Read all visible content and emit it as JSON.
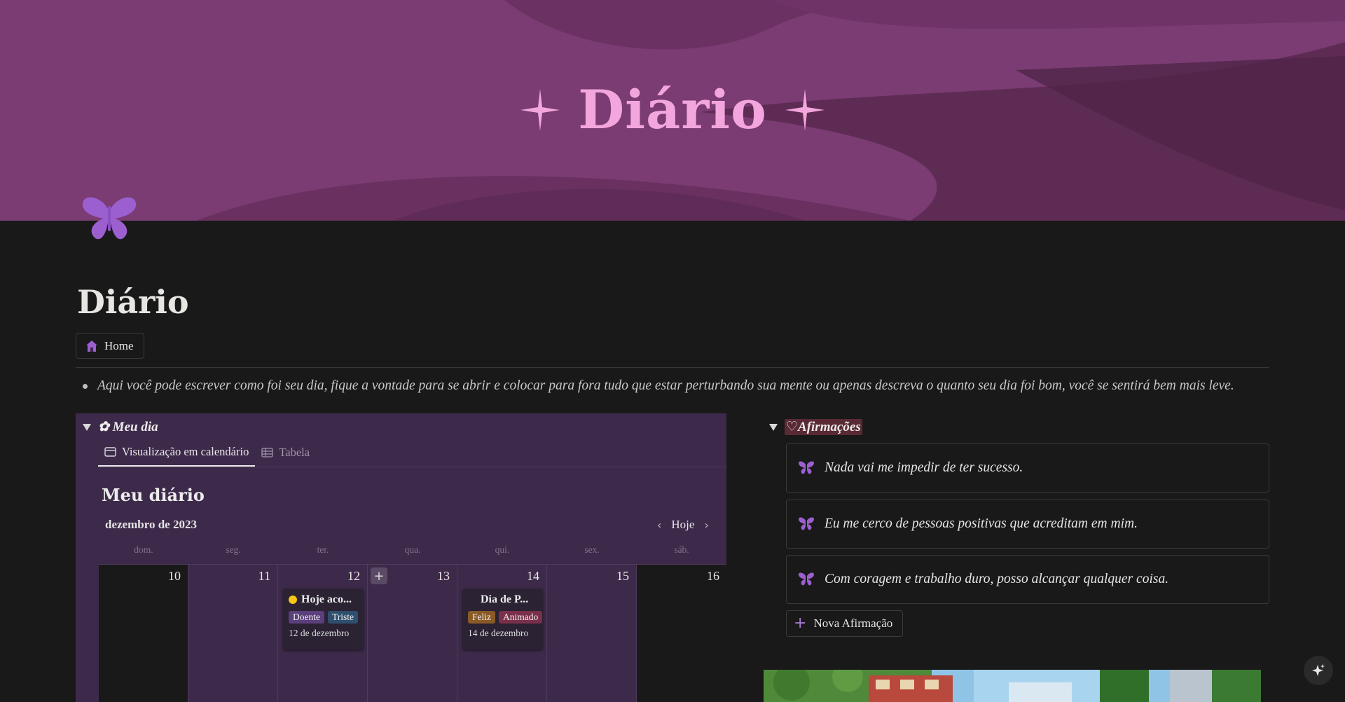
{
  "cover": {
    "title": "Diário"
  },
  "page": {
    "title": "Diário",
    "home_link": "Home",
    "description": "Aqui você pode escrever como foi seu dia, fique a vontade para se abrir e colocar para fora tudo que estar perturbando sua mente ou apenas descreva o quanto seu dia foi bom, você se sentirá bem mais leve."
  },
  "meu_dia": {
    "toggle_label": "✿ Meu dia",
    "tabs": [
      "Visualização em calendário",
      "Tabela"
    ],
    "calendar_title": "Meu diário",
    "month": "dezembro de 2023",
    "today_label": "Hoje",
    "weekdays": [
      "dom.",
      "seg.",
      "ter.",
      "qua.",
      "qui.",
      "sex.",
      "sáb."
    ],
    "days": [
      "10",
      "11",
      "12",
      "13",
      "14",
      "15",
      "16"
    ],
    "entries": [
      {
        "title": "Hoje aco...",
        "tags": [
          "Doente",
          "Triste"
        ],
        "date": "12 de dezembro"
      },
      {
        "title": "Dia de P...",
        "tags": [
          "Feliz",
          "Animado"
        ],
        "date": "14 de dezembro"
      }
    ]
  },
  "afirmacoes": {
    "toggle_label": "♡Afirmações",
    "items": [
      "Nada vai me impedir de ter sucesso.",
      "Eu me cerco de pessoas positivas que acreditam em mim.",
      "Com coragem e trabalho duro, posso alcançar qualquer coisa."
    ],
    "new_button": "Nova Afirmação"
  },
  "colors": {
    "cover": "#7a3c72",
    "accent_pink": "#f3a6dd",
    "butterfly": "#9b5fd0",
    "panel": "#3d2a4b",
    "tag_doente": "#5b3f7a",
    "tag_triste": "#2f4f6e",
    "tag_feliz": "#8a5a26",
    "tag_animado": "#7a2f4a"
  },
  "icons": [
    "sparkle-icon",
    "butterfly-icon",
    "house-icon",
    "calendar-icon",
    "table-icon",
    "chevron-left-icon",
    "chevron-right-icon",
    "plus-icon",
    "ai-sparkle-icon"
  ]
}
